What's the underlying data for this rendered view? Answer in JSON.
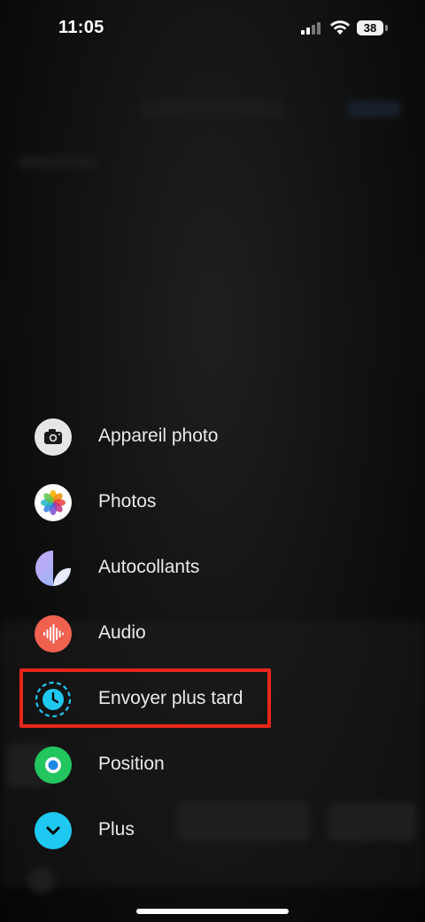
{
  "status_bar": {
    "time": "11:05",
    "battery": "38"
  },
  "menu": {
    "items": [
      {
        "id": "camera",
        "label": "Appareil photo",
        "icon": "camera-icon",
        "icon_bg": "#e6e6e6"
      },
      {
        "id": "photos",
        "label": "Photos",
        "icon": "photos-icon",
        "icon_bg": "#ffffff"
      },
      {
        "id": "stickers",
        "label": "Autocollants",
        "icon": "sticker-icon",
        "icon_bg": "#b7a8f5"
      },
      {
        "id": "audio",
        "label": "Audio",
        "icon": "waveform-icon",
        "icon_bg": "#f0614f"
      },
      {
        "id": "send-later",
        "label": "Envoyer plus tard",
        "icon": "clock-icon",
        "icon_bg": "#1ec8f0"
      },
      {
        "id": "location",
        "label": "Position",
        "icon": "location-icon",
        "icon_bg": "#22c55e"
      },
      {
        "id": "more",
        "label": "Plus",
        "icon": "chevron-down-icon",
        "icon_bg": "#1ec8f0"
      }
    ]
  },
  "colors": {
    "highlight": "#e8261b",
    "accent": "#1ec8f0"
  }
}
